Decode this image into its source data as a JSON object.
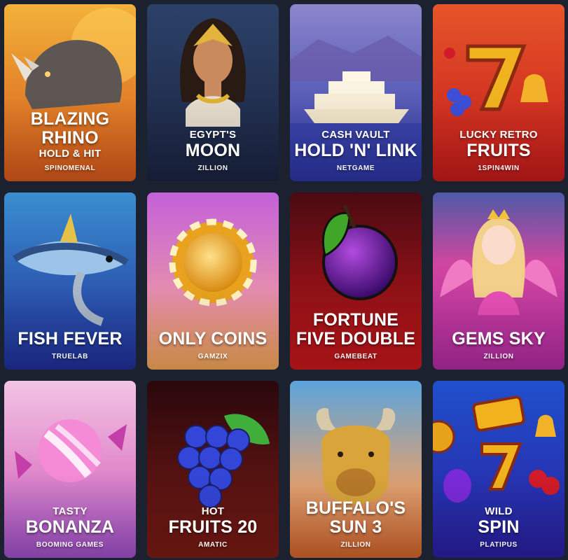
{
  "games": [
    {
      "lines": [
        "BLAZING",
        "RHINO",
        "HOLD & HIT"
      ],
      "styles": [
        "big",
        "big",
        "small"
      ],
      "provider": "SPINOMENAL",
      "icon": "rhino-icon",
      "bg": [
        "#e9a32e",
        "#d85a14"
      ]
    },
    {
      "lines": [
        "EGYPT'S",
        "MOON"
      ],
      "styles": [
        "small",
        "big"
      ],
      "provider": "ZILLION",
      "icon": "egyptian-queen-icon",
      "bg": [
        "#2a3a5e",
        "#1b2540"
      ]
    },
    {
      "lines": [
        "CASH VAULT",
        "HOLD 'N' LINK"
      ],
      "styles": [
        "small",
        "big"
      ],
      "provider": "NETGAME",
      "icon": "cruise-ship-icon",
      "bg": [
        "#7a82c8",
        "#2d33a0"
      ]
    },
    {
      "lines": [
        "LUCKY RETRO",
        "FRUITS"
      ],
      "styles": [
        "small",
        "big"
      ],
      "provider": "1SPIN4WIN",
      "icon": "lucky-seven-icon",
      "bg": [
        "#d63a1c",
        "#c41b1b"
      ]
    },
    {
      "lines": [
        "FISH FEVER"
      ],
      "styles": [
        "big"
      ],
      "provider": "TRUELAB",
      "icon": "tuna-fish-icon",
      "bg": [
        "#2f7fc6",
        "#1f2f9a"
      ]
    },
    {
      "lines": [
        "ONLY COINS"
      ],
      "styles": [
        "big"
      ],
      "provider": "GAMZIX",
      "icon": "gold-coin-icon",
      "bg": [
        "#c265d8",
        "#f0a25c"
      ]
    },
    {
      "lines": [
        "FORTUNE",
        "FIVE DOUBLE"
      ],
      "styles": [
        "big",
        "big"
      ],
      "provider": "GAMEBEAT",
      "icon": "plum-icon",
      "bg": [
        "#5e0b14",
        "#c31518"
      ]
    },
    {
      "lines": [
        "GEMS SKY"
      ],
      "styles": [
        "big"
      ],
      "provider": "ZILLION",
      "icon": "princess-icon",
      "bg": [
        "#d8479c",
        "#b02aa0"
      ]
    },
    {
      "lines": [
        "TASTY",
        "BONANZA"
      ],
      "styles": [
        "small",
        "big"
      ],
      "provider": "BOOMING GAMES",
      "icon": "candy-icon",
      "bg": [
        "#e9a8d8",
        "#a64fc6"
      ]
    },
    {
      "lines": [
        "HOT",
        "FRUITS 20"
      ],
      "styles": [
        "small",
        "big"
      ],
      "provider": "AMATIC",
      "icon": "grapes-icon",
      "bg": [
        "#3a0a0e",
        "#7e1a16"
      ]
    },
    {
      "lines": [
        "BUFFALO'S",
        "SUN 3"
      ],
      "styles": [
        "big",
        "big"
      ],
      "provider": "ZILLION",
      "icon": "buffalo-icon",
      "bg": [
        "#5ea2da",
        "#d26a2a"
      ]
    },
    {
      "lines": [
        "WILD",
        "SPIN"
      ],
      "styles": [
        "small",
        "big"
      ],
      "provider": "PLATIPUS",
      "icon": "slot-symbols-icon",
      "bg": [
        "#1f49c8",
        "#2a1e9e"
      ]
    }
  ]
}
